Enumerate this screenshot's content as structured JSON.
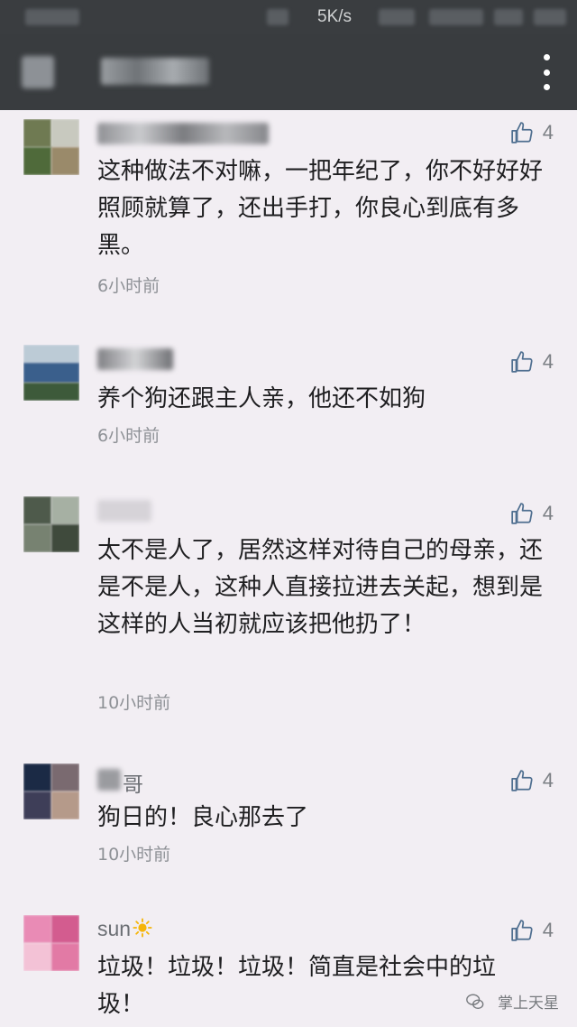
{
  "status_bar": {
    "network_speed": "5K/s",
    "time": ""
  },
  "nav": {
    "title": ""
  },
  "comments": [
    {
      "name": "",
      "likes": "4",
      "text": "这种做法不对嘛，一把年纪了，你不好好好照顾就算了，还出手打，你良心到底有多黑。",
      "time": "6小时前"
    },
    {
      "name": "",
      "likes": "4",
      "text": "养个狗还跟主人亲，他还不如狗",
      "time": "6小时前"
    },
    {
      "name": "",
      "likes": "4",
      "text": "太不是人了，居然这样对待自己的母亲，还是不是人，这种人直接拉进去关起，想到是这样的人当初就应该把他扔了！",
      "time": "10小时前"
    },
    {
      "name": "哥",
      "likes": "4",
      "text": "狗日的！良心那去了",
      "time": "10小时前"
    },
    {
      "name": "sun",
      "likes": "4",
      "text": "垃圾！垃圾！垃圾！简直是社会中的垃圾！",
      "time": ""
    }
  ],
  "watermark": {
    "text": "掌上天星"
  },
  "colors": {
    "nav_bg": "#393c3f",
    "page_bg": "#f2eef3",
    "like_icon": "#4f6f90"
  }
}
